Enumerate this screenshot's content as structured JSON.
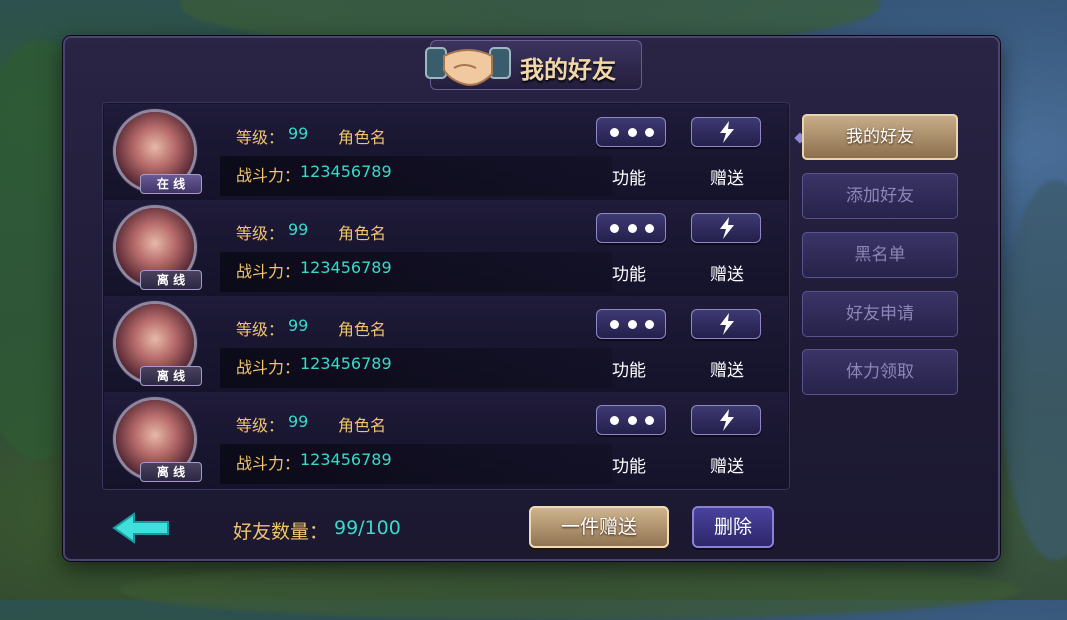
{
  "title": "我的好友",
  "friends": [
    {
      "level_label": "等级：",
      "level": "99",
      "role": "角色名",
      "power_label": "战斗力：",
      "power": "123456789",
      "status": "在 线",
      "more_label": "功能",
      "gift_label": "赠送"
    },
    {
      "level_label": "等级：",
      "level": "99",
      "role": "角色名",
      "power_label": "战斗力：",
      "power": "123456789",
      "status": "离 线",
      "more_label": "功能",
      "gift_label": "赠送"
    },
    {
      "level_label": "等级：",
      "level": "99",
      "role": "角色名",
      "power_label": "战斗力：",
      "power": "123456789",
      "status": "离 线",
      "more_label": "功能",
      "gift_label": "赠送"
    },
    {
      "level_label": "等级：",
      "level": "99",
      "role": "角色名",
      "power_label": "战斗力：",
      "power": "123456789",
      "status": "离 线",
      "more_label": "功能",
      "gift_label": "赠送"
    }
  ],
  "side_menu": {
    "my_friends": "我的好友",
    "add_friend": "添加好友",
    "blacklist": "黑名单",
    "requests": "好友申请",
    "stamina": "体力领取"
  },
  "footer": {
    "count_label": "好友数量：",
    "count_value": "99/100",
    "gift_all": "一件赠送",
    "delete": "删除"
  },
  "colors": {
    "gold": "#f0c46a",
    "cyan": "#38d9c9",
    "panel": "#1f1b36"
  },
  "icons": [
    "handshake-icon",
    "more-icon",
    "lightning-icon",
    "back-arrow-icon"
  ]
}
